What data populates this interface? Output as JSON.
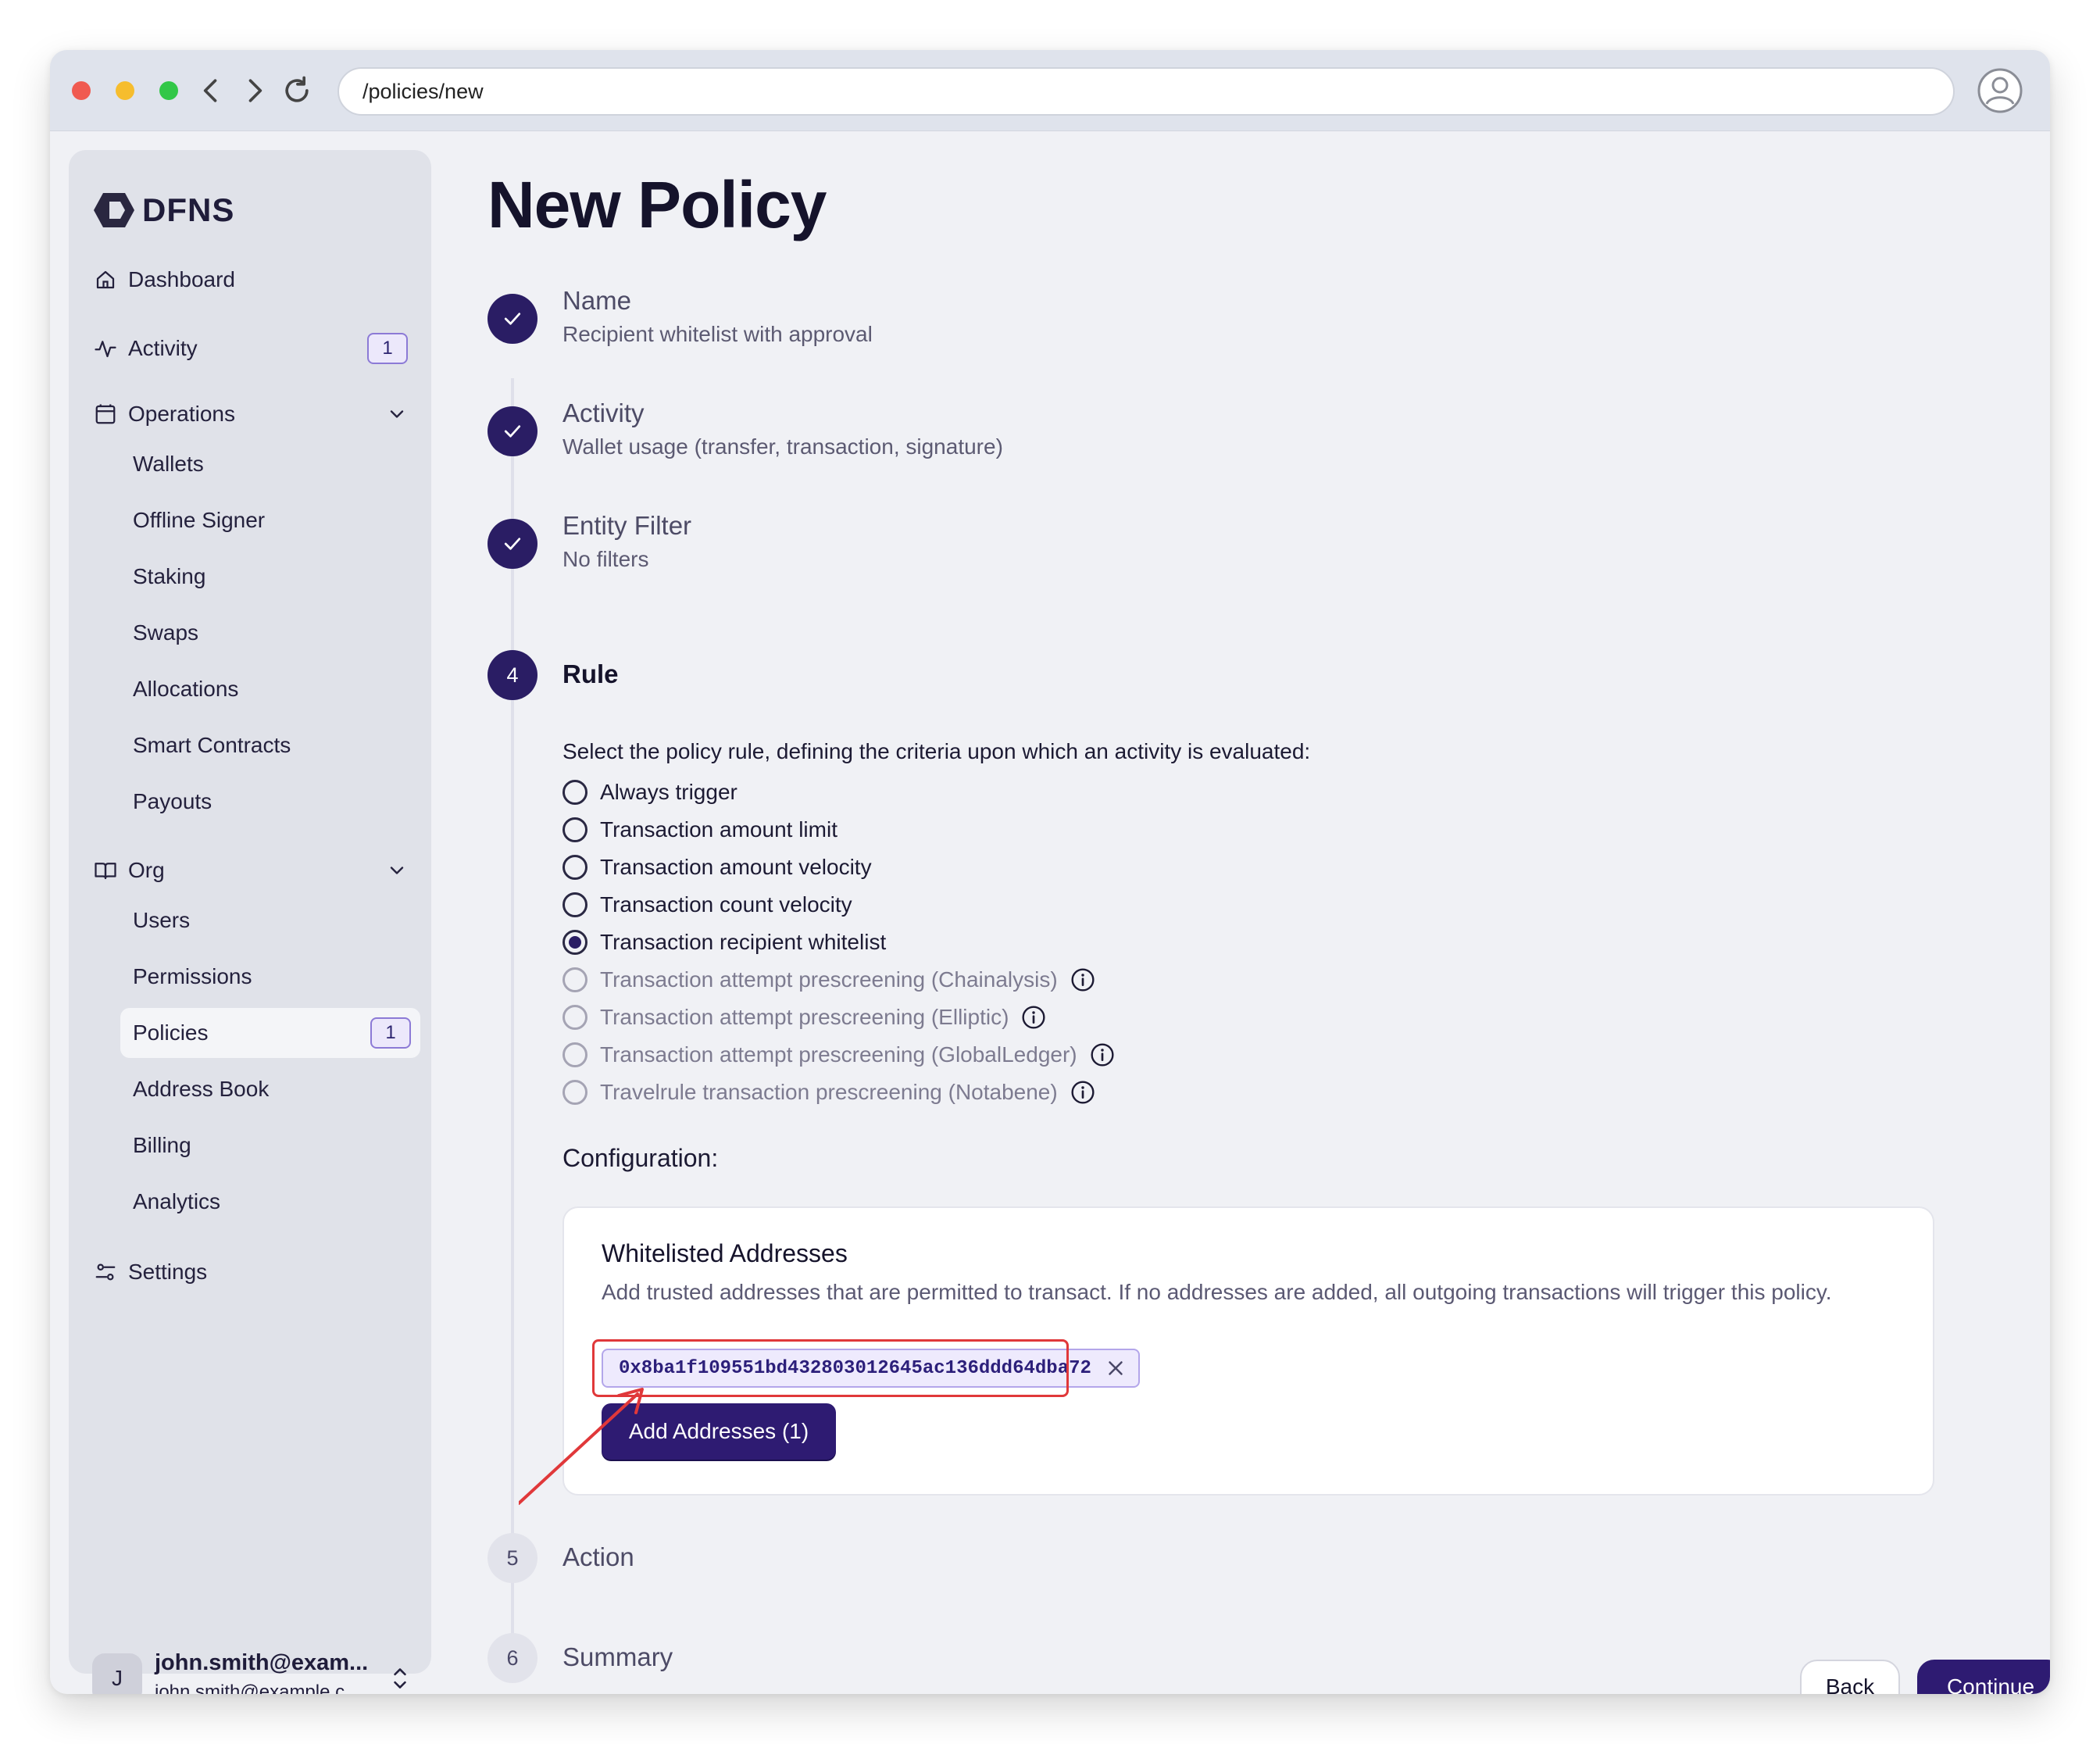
{
  "browser": {
    "url": "/policies/new"
  },
  "sidebar": {
    "logo": "DFNS",
    "items": [
      {
        "label": "Dashboard",
        "icon": "home-icon"
      },
      {
        "label": "Activity",
        "icon": "activity-icon",
        "badge": "1"
      },
      {
        "label": "Operations",
        "icon": "operations-icon",
        "expanded": true,
        "children": [
          "Wallets",
          "Offline Signer",
          "Staking",
          "Swaps",
          "Allocations",
          "Smart Contracts",
          "Payouts"
        ]
      },
      {
        "label": "Org",
        "icon": "book-icon",
        "expanded": true,
        "children": [
          "Users",
          "Permissions",
          "Policies",
          "Address Book",
          "Billing",
          "Analytics"
        ]
      },
      {
        "label": "Settings",
        "icon": "settings-icon"
      }
    ],
    "policies_badge": "1",
    "user": {
      "initial": "J",
      "name": "john.smith@exam...",
      "email": "john.smith@example.c..."
    }
  },
  "page": {
    "title": "New Policy",
    "steps": [
      {
        "number": "1",
        "title": "Name",
        "summary": "Recipient whitelist with approval",
        "status": "done"
      },
      {
        "number": "2",
        "title": "Activity",
        "summary": "Wallet usage (transfer, transaction, signature)",
        "status": "done"
      },
      {
        "number": "3",
        "title": "Entity Filter",
        "summary": "No filters",
        "status": "done"
      },
      {
        "number": "4",
        "title": "Rule",
        "status": "current"
      },
      {
        "number": "5",
        "title": "Action",
        "status": "pending"
      },
      {
        "number": "6",
        "title": "Summary",
        "status": "pending"
      }
    ],
    "rule": {
      "description": "Select the policy rule, defining the criteria upon which an activity is evaluated:",
      "options": [
        {
          "label": "Always trigger",
          "selected": false,
          "disabled": false
        },
        {
          "label": "Transaction amount limit",
          "selected": false,
          "disabled": false
        },
        {
          "label": "Transaction amount velocity",
          "selected": false,
          "disabled": false
        },
        {
          "label": "Transaction count velocity",
          "selected": false,
          "disabled": false
        },
        {
          "label": "Transaction recipient whitelist",
          "selected": true,
          "disabled": false
        },
        {
          "label": "Transaction attempt prescreening (Chainalysis)",
          "selected": false,
          "disabled": true
        },
        {
          "label": "Transaction attempt prescreening (Elliptic)",
          "selected": false,
          "disabled": true
        },
        {
          "label": "Transaction attempt prescreening (GlobalLedger)",
          "selected": false,
          "disabled": true
        },
        {
          "label": "Travelrule transaction prescreening (Notabene)",
          "selected": false,
          "disabled": true
        }
      ]
    },
    "configuration": {
      "label": "Configuration:",
      "card_title": "Whitelisted Addresses",
      "card_description": "Add trusted addresses that are permitted to transact. If no addresses are added, all outgoing transactions will trigger this policy.",
      "addresses": [
        "0x8ba1f109551bd432803012645ac136ddd64dba72"
      ],
      "add_button": "Add Addresses (1)"
    },
    "footer": {
      "back": "Back",
      "continue": "Continue"
    }
  },
  "colors": {
    "primary": "#2e1b72",
    "annotation": "#e0383a"
  }
}
